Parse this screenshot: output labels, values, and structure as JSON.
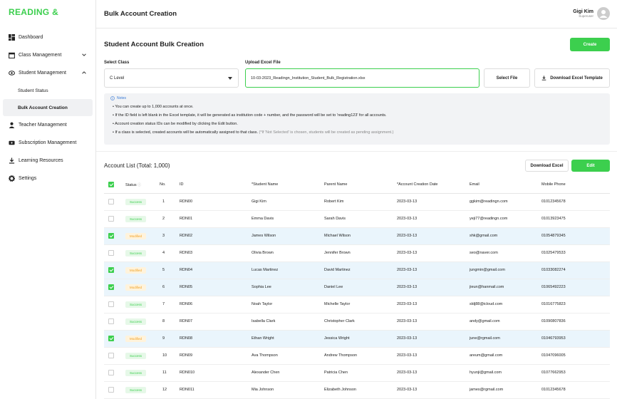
{
  "sidebar": {
    "logo": "READING &",
    "items": [
      {
        "label": "Dashboard"
      },
      {
        "label": "Class Management"
      },
      {
        "label": "Student Management"
      },
      {
        "label": "Student Status"
      },
      {
        "label": "Bulk Account Creation"
      },
      {
        "label": "Teacher Management"
      },
      {
        "label": "Subscription Management"
      },
      {
        "label": "Learning Resources"
      },
      {
        "label": "Settings"
      }
    ]
  },
  "header": {
    "title": "Bulk Account Creation",
    "user_name": "Gigi Kim",
    "user_role": "Superuser"
  },
  "form": {
    "section_title": "Student Account Bulk Creation",
    "create_label": "Create",
    "select_class_label": "Select Class",
    "select_class_value": "C Level",
    "upload_label": "Upload Excel File",
    "file_name": "10-03-2023_Readingn_Institution_Student_Bulk_Registration.xlsx",
    "select_file_label": "Select File",
    "download_template_label": "Download Excel Template"
  },
  "notes": {
    "title": "Notes",
    "lines": [
      "You can create up to 1,000 accounts at once.",
      "If the ID field is left blank in the Excel template, it will be generated as institution code + number, and the password will be set to 'reading123' for all accounts.",
      "Account creation status IDs can be modified by clicking the Edit button.",
      "If a class is selected, created accounts will be automatically assigned to that class."
    ],
    "line4_gray": "(*If 'Not Selected' is chosen, students will be created as pending assignment.)"
  },
  "list": {
    "title": "Account List (Total: 1,000)",
    "download_label": "Download Excel",
    "edit_label": "Edit",
    "columns": [
      "Status",
      "No.",
      "ID",
      "*Student Name",
      "Parent Name",
      "*Account Creation Date",
      "Email",
      "Mobile Phone"
    ],
    "rows": [
      {
        "checked": false,
        "status": "Success",
        "no": "1",
        "id": "RDN00",
        "student": "Gigi Kim",
        "parent": "Robert Kim",
        "date": "2023-03-13",
        "email": "ggkim@readingn.com",
        "phone": "01012345678"
      },
      {
        "checked": false,
        "status": "Success",
        "no": "2",
        "id": "RDN01",
        "student": "Emma Davis",
        "parent": "Sarah Davis",
        "date": "2023-03-13",
        "email": "yeji77@readingn.com",
        "phone": "01013923475"
      },
      {
        "checked": true,
        "status": "Modified",
        "no": "3",
        "id": "RDN02",
        "student": "James Wilson",
        "parent": "Michael Wilson",
        "date": "2023-03-13",
        "email": "shk@gmail.com",
        "phone": "01054879345"
      },
      {
        "checked": false,
        "status": "Success",
        "no": "4",
        "id": "RDN03",
        "student": "Olivia Brown",
        "parent": "Jennifer Brown",
        "date": "2023-03-13",
        "email": "seo@naver.com",
        "phone": "01025479533"
      },
      {
        "checked": true,
        "status": "Modified",
        "no": "5",
        "id": "RDN04",
        "student": "Lucas Martinez",
        "parent": "David Martinez",
        "date": "2023-03-13",
        "email": "jungmin@gmail.com",
        "phone": "01033082274"
      },
      {
        "checked": true,
        "status": "Modified",
        "no": "6",
        "id": "RDN05",
        "student": "Sophia Lee",
        "parent": "Daniel Lee",
        "date": "2023-03-13",
        "email": "jieun@hanmail.com",
        "phone": "01065492223"
      },
      {
        "checked": false,
        "status": "Success",
        "no": "7",
        "id": "RDN06",
        "student": "Noah Taylor",
        "parent": "Michelle Taylor",
        "date": "2023-03-13",
        "email": "sldj88@icloud.com",
        "phone": "01016775823"
      },
      {
        "checked": false,
        "status": "Success",
        "no": "8",
        "id": "RDN07",
        "student": "Isabella Clark",
        "parent": "Christopher Clark",
        "date": "2023-03-13",
        "email": "andy@gmail.com",
        "phone": "01090807836"
      },
      {
        "checked": true,
        "status": "Modified",
        "no": "9",
        "id": "RDN08",
        "student": "Ethan Wright",
        "parent": "Jessica Wright",
        "date": "2023-03-13",
        "email": "june@rgmail.com",
        "phone": "01046793953"
      },
      {
        "checked": false,
        "status": "Success",
        "no": "10",
        "id": "RDN09",
        "student": "Ava Thompson",
        "parent": "Andrew Thompson",
        "date": "2023-03-13",
        "email": "areum@gmail.com",
        "phone": "01047096005"
      },
      {
        "checked": false,
        "status": "Success",
        "no": "11",
        "id": "RDN010",
        "student": "Alexander Chen",
        "parent": "Patricia Chen",
        "date": "2023-03-13",
        "email": "hyunji@gmail.com",
        "phone": "01077662953"
      },
      {
        "checked": false,
        "status": "Success",
        "no": "12",
        "id": "RDN011",
        "student": "Mia Johnson",
        "parent": "Elizabeth Johnson",
        "date": "2023-03-13",
        "email": "james@rgmail.com",
        "phone": "01012345678"
      }
    ]
  },
  "colors": {
    "accent": "#3ccf4e",
    "selected_row": "#eaf5fc",
    "modified": "#f0a020"
  }
}
